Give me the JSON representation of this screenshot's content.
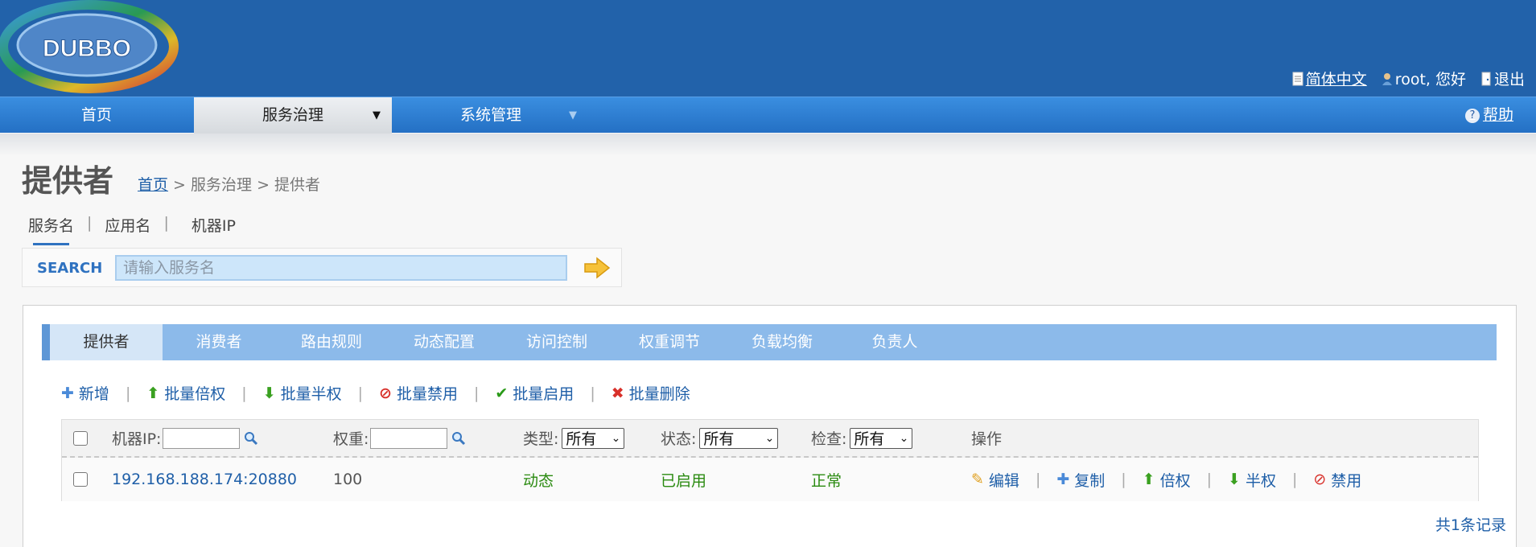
{
  "logo": {
    "text": "DUBBO"
  },
  "header": {
    "language": "简体中文",
    "greeting": "root, 您好",
    "logout": "退出"
  },
  "nav": {
    "items": [
      {
        "label": "首页"
      },
      {
        "label": "服务治理"
      },
      {
        "label": "系统管理"
      }
    ],
    "help": "帮助"
  },
  "page": {
    "title": "提供者",
    "breadcrumb": {
      "home": "首页",
      "sep1": " > ",
      "section": "服务治理",
      "sep2": " > ",
      "current": "提供者"
    }
  },
  "search": {
    "tabs": [
      "服务名",
      "应用名",
      "机器IP"
    ],
    "label": "SEARCH",
    "placeholder": "请输入服务名"
  },
  "panel": {
    "tabs": [
      "提供者",
      "消费者",
      "路由规则",
      "动态配置",
      "访问控制",
      "权重调节",
      "负载均衡",
      "负责人"
    ],
    "toolbar": [
      {
        "label": "新增",
        "icon": "plus-icon"
      },
      {
        "label": "批量倍权",
        "icon": "arrow-up-icon"
      },
      {
        "label": "批量半权",
        "icon": "arrow-down-icon"
      },
      {
        "label": "批量禁用",
        "icon": "ban-icon"
      },
      {
        "label": "批量启用",
        "icon": "check-icon"
      },
      {
        "label": "批量删除",
        "icon": "x-icon"
      }
    ],
    "columns": {
      "ip": "机器IP:",
      "weight": "权重:",
      "type": "类型:",
      "type_value": "所有",
      "status": "状态:",
      "status_value": "所有",
      "check": "检查:",
      "check_value": "所有",
      "actions": "操作"
    },
    "rows": [
      {
        "address": "192.168.188.174:20880",
        "weight": "100",
        "type": "动态",
        "status": "已启用",
        "check": "正常",
        "ops": [
          "编辑",
          "复制",
          "倍权",
          "半权",
          "禁用"
        ]
      }
    ],
    "total": "共1条记录"
  },
  "colors": {
    "header": "#2262aa",
    "nav": "#2f7ad2",
    "tabbar": "#8cbaea",
    "link": "#1f5fa8",
    "ok": "#2a8a10"
  }
}
